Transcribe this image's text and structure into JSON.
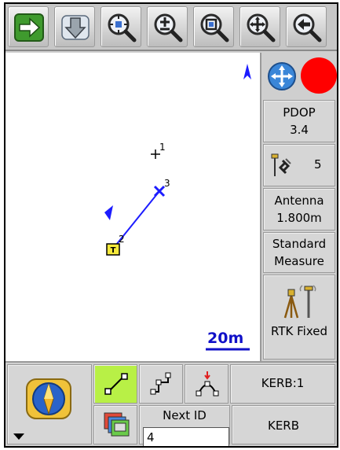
{
  "toolbar": {
    "buttons": [
      {
        "name": "next-arrow-icon"
      },
      {
        "name": "download-icon"
      },
      {
        "name": "zoom-center-icon"
      },
      {
        "name": "zoom-in-out-icon"
      },
      {
        "name": "zoom-extent-icon"
      },
      {
        "name": "pan-move-icon"
      },
      {
        "name": "back-arrow-icon"
      }
    ]
  },
  "map": {
    "points": [
      {
        "id": "1",
        "marker": "plus"
      },
      {
        "id": "2",
        "marker": "target-box",
        "box_label": "T"
      },
      {
        "id": "3",
        "marker": "cross"
      }
    ],
    "scale_label": "20m",
    "colors": {
      "line": "#1c1cff",
      "scale": "#1010c8",
      "target_box": "#f6ea3c",
      "status_dot": "#ff0000"
    }
  },
  "panel": {
    "pdop_label": "PDOP",
    "pdop_value": "3.4",
    "satellites": "5",
    "antenna_label": "Antenna",
    "antenna_height": "1.800m",
    "measure_line1": "Standard",
    "measure_line2": "Measure",
    "rtk_status": "RTK Fixed"
  },
  "bottom": {
    "code_label": "KERB:1",
    "next_id_label": "Next ID",
    "next_id_value": "4",
    "code_name": "KERB"
  }
}
